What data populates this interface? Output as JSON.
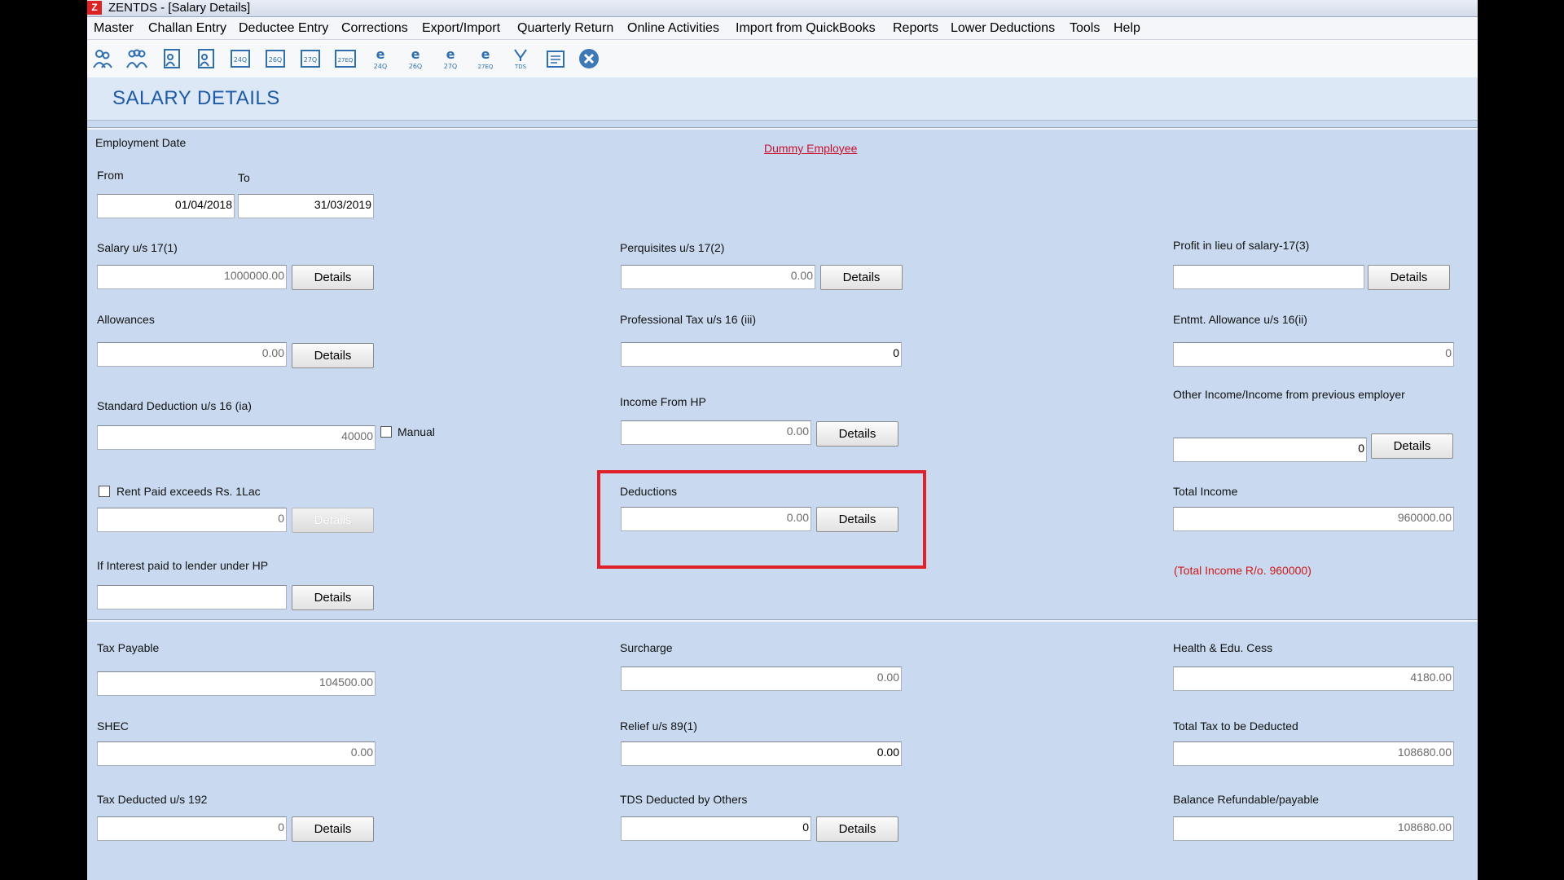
{
  "window": {
    "title": "ZENTDS - [Salary Details]"
  },
  "menu": [
    "Master",
    "Challan Entry",
    "Deductee Entry",
    "Corrections",
    "Export/Import",
    "Quarterly Return",
    "Online Activities",
    "Import from QuickBooks",
    "Reports",
    "Lower Deductions",
    "Tools",
    "Help"
  ],
  "toolbar": {
    "labels": [
      "24Q",
      "26Q",
      "27Q",
      "27EQ",
      "24Q",
      "26Q",
      "27Q",
      "27EQ",
      "TDS"
    ]
  },
  "page": {
    "title": "SALARY DETAILS",
    "employee_link": "Dummy Employee"
  },
  "employment": {
    "label": "Employment Date",
    "from_label": "From",
    "to_label": "To",
    "from": "01/04/2018",
    "to": "31/03/2019"
  },
  "fields": {
    "salary": {
      "label": "Salary u/s 17(1)",
      "value": "1000000.00"
    },
    "perquisites": {
      "label": "Perquisites u/s 17(2)",
      "value": "0.00"
    },
    "profit_lieu": {
      "label": "Profit in lieu of salary-17(3)",
      "value": ""
    },
    "allowances": {
      "label": "Allowances",
      "value": "0.00"
    },
    "professional_tax": {
      "label": "Professional Tax u/s 16 (iii)",
      "value": "0"
    },
    "entmt_allowance": {
      "label": "Entmt. Allowance u/s 16(ii)",
      "value": "0"
    },
    "standard_deduction": {
      "label": "Standard Deduction u/s 16 (ia)",
      "value": "40000",
      "manual_label": "Manual"
    },
    "income_hp": {
      "label": "Income From HP",
      "value": "0.00"
    },
    "other_income": {
      "label": "Other Income/Income from previous employer",
      "value": "0"
    },
    "rent_paid": {
      "label": "Rent Paid exceeds Rs. 1Lac",
      "value": "0"
    },
    "deductions": {
      "label": "Deductions",
      "value": "0.00"
    },
    "total_income": {
      "label": "Total Income",
      "value": "960000.00",
      "note": "(Total Income R/o. 960000)"
    },
    "interest_paid": {
      "label": "If Interest paid to lender under HP",
      "value": ""
    },
    "tax_payable": {
      "label": "Tax Payable",
      "value": "104500.00"
    },
    "surcharge": {
      "label": "Surcharge",
      "value": "0.00"
    },
    "cess": {
      "label": "Health & Edu. Cess",
      "value": "4180.00"
    },
    "shec": {
      "label": "SHEC",
      "value": "0.00"
    },
    "relief": {
      "label": "Relief u/s 89(1)",
      "value": "0.00"
    },
    "total_tax": {
      "label": "Total Tax to be Deducted",
      "value": "108680.00"
    },
    "tax_192": {
      "label": "Tax Deducted u/s 192",
      "value": "0"
    },
    "tds_others": {
      "label": "TDS Deducted by Others",
      "value": "0"
    },
    "balance": {
      "label": "Balance Refundable/payable",
      "value": "108680.00"
    }
  },
  "buttons": {
    "details": "Details"
  }
}
